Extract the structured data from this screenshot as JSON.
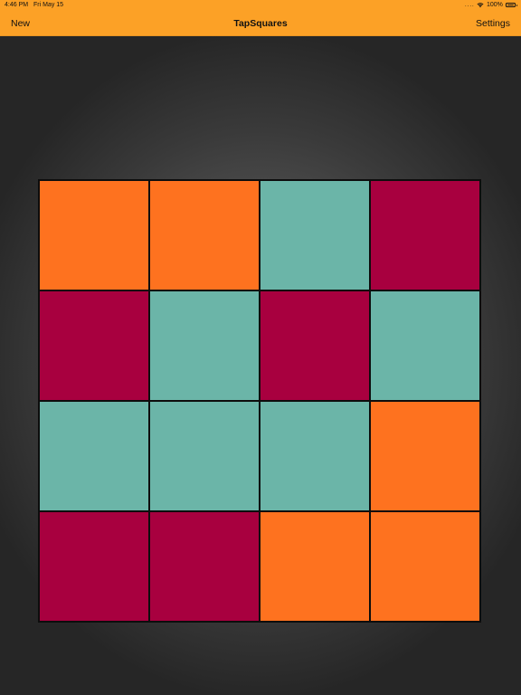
{
  "status_bar": {
    "time": "4:46 PM",
    "date": "Fri May 15",
    "signal": "....",
    "battery": "100%"
  },
  "nav": {
    "left_label": "New",
    "title": "TapSquares",
    "right_label": "Settings"
  },
  "colors": {
    "accent": "#fca126",
    "orange": "#fe721f",
    "teal": "#6bb5a8",
    "crimson": "#a8003f"
  },
  "board": {
    "rows": 4,
    "cols": 4,
    "cells": [
      [
        "orange",
        "orange",
        "teal",
        "crimson"
      ],
      [
        "crimson",
        "teal",
        "crimson",
        "teal"
      ],
      [
        "teal",
        "teal",
        "teal",
        "orange"
      ],
      [
        "crimson",
        "crimson",
        "orange",
        "orange"
      ]
    ]
  }
}
